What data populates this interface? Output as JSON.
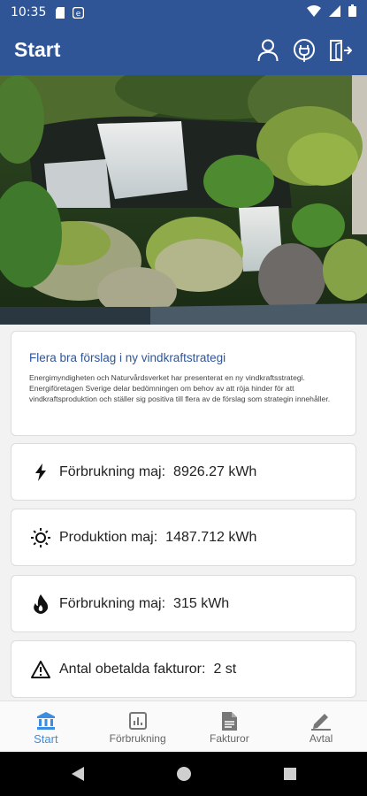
{
  "status_bar": {
    "time": "10:35",
    "icons": [
      "sd-card-icon",
      "at-sign-icon",
      "wifi-icon",
      "signal-icon",
      "battery-icon"
    ]
  },
  "app_bar": {
    "title": "Start",
    "actions": [
      "user-icon",
      "plug-icon",
      "logout-icon"
    ],
    "color": "#2f5597"
  },
  "news": {
    "title": "Flera bra förslag i ny vindkraftstrategi",
    "body": "Energimyndigheten och Naturvårdsverket har presenterat en ny vindkraftsstrategi. Energiföretagen Sverige delar bedömningen om behov av att röja hinder för att vindkraftsproduktion och ställer sig positiva till flera av de förslag som strategin innehåller."
  },
  "stats": [
    {
      "icon": "lightning-icon",
      "label": "Förbrukning maj:",
      "value": "8926.27 kWh"
    },
    {
      "icon": "sun-icon",
      "label": "Produktion maj:",
      "value": "1487.712 kWh"
    },
    {
      "icon": "flame-icon",
      "label": "Förbrukning maj:",
      "value": "315 kWh"
    },
    {
      "icon": "warning-icon",
      "label": "Antal obetalda fakturor:",
      "value": "2 st"
    }
  ],
  "bottom_nav": [
    {
      "icon": "bank-icon",
      "label": "Start",
      "active": true
    },
    {
      "icon": "bar-chart-icon",
      "label": "Förbrukning",
      "active": false
    },
    {
      "icon": "document-icon",
      "label": "Fakturor",
      "active": false
    },
    {
      "icon": "pen-icon",
      "label": "Avtal",
      "active": false
    }
  ],
  "accent_color": "#3d8de0"
}
